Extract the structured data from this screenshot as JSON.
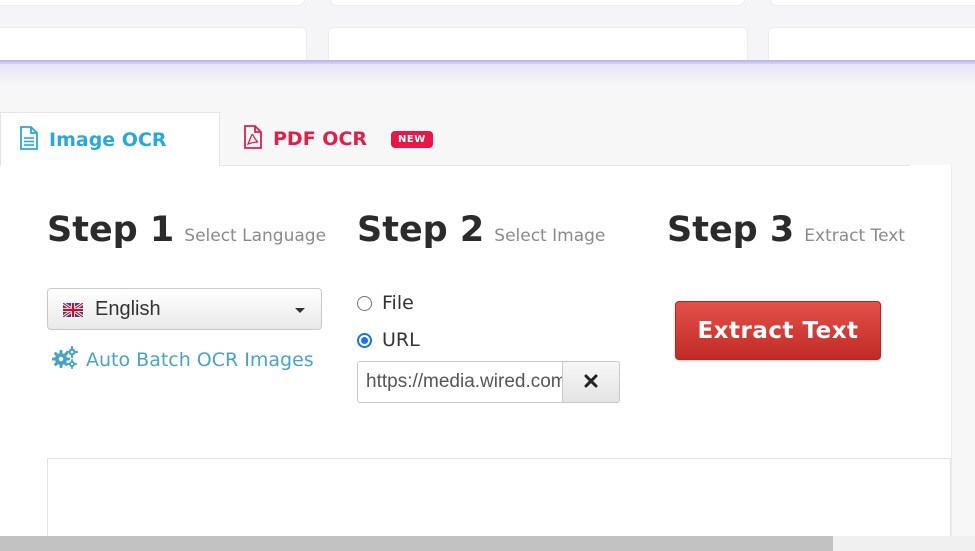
{
  "tabs": [
    {
      "label": "Image OCR",
      "icon": "document-icon",
      "active": true
    },
    {
      "label": "PDF OCR",
      "icon": "pdf-file-icon",
      "badge": "NEW",
      "active": false
    }
  ],
  "steps": {
    "step1": {
      "title": "Step 1",
      "subtitle": "Select Language"
    },
    "step2": {
      "title": "Step 2",
      "subtitle": "Select Image"
    },
    "step3": {
      "title": "Step 3",
      "subtitle": "Extract Text"
    }
  },
  "language": {
    "selected": "English",
    "flag_icon": "uk-flag-icon"
  },
  "batch": {
    "label": "Auto Batch OCR Images",
    "icon": "gears-icon"
  },
  "source": {
    "options": [
      {
        "label": "File",
        "checked": false
      },
      {
        "label": "URL",
        "checked": true
      }
    ],
    "url_value": "https://media.wired.com/",
    "clear_icon": "close-icon"
  },
  "actions": {
    "extract_label": "Extract Text"
  },
  "colors": {
    "image_tab": "#2aa8d8",
    "pdf_tab": "#e0204a",
    "badge": "#e8174a",
    "extract_button": "#d13a34",
    "link": "#4aa3c4"
  }
}
